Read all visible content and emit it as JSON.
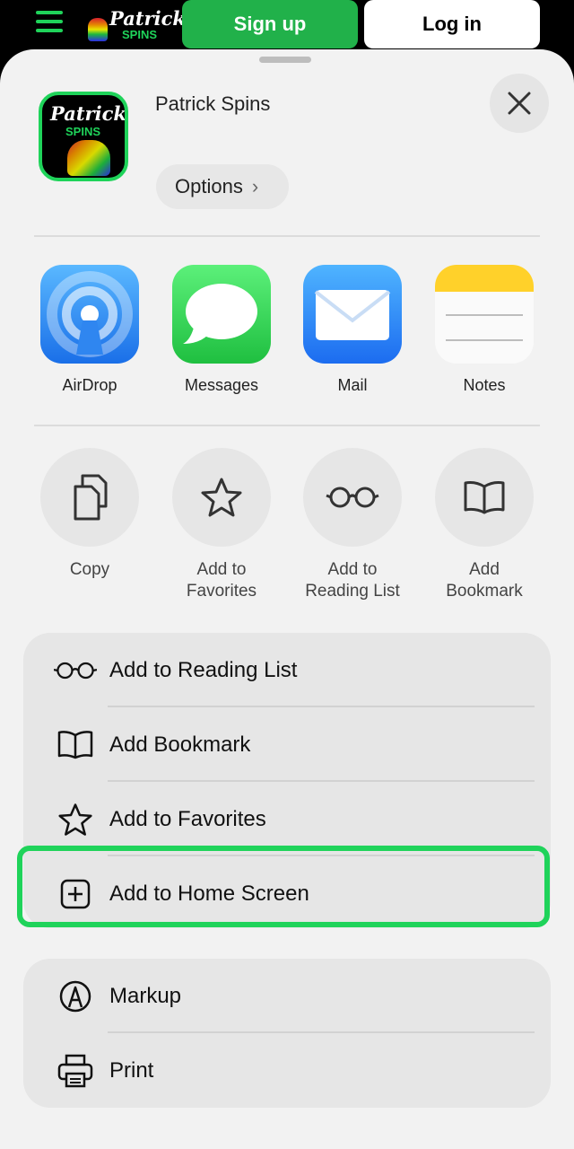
{
  "site_header": {
    "logo_line1": "Patrick",
    "logo_line2": "SPINS",
    "signup_label": "Sign up",
    "login_label": "Log in"
  },
  "share_sheet": {
    "app_name": "Patrick Spins",
    "app_icon_line1": "Patrick",
    "app_icon_line2": "SPINS",
    "options_label": "Options",
    "apps": [
      {
        "label": "AirDrop",
        "icon": "airdrop-icon"
      },
      {
        "label": "Messages",
        "icon": "messages-icon"
      },
      {
        "label": "Mail",
        "icon": "mail-icon"
      },
      {
        "label": "Notes",
        "icon": "notes-icon"
      }
    ],
    "actions": [
      {
        "label": "Copy",
        "icon": "copy-icon"
      },
      {
        "label": "Add to\nFavorites",
        "icon": "star-icon"
      },
      {
        "label": "Add to\nReading List",
        "icon": "glasses-icon"
      },
      {
        "label": "Add\nBookmark",
        "icon": "book-icon"
      }
    ],
    "list1": [
      {
        "label": "Add to Reading List",
        "icon": "glasses-icon"
      },
      {
        "label": "Add Bookmark",
        "icon": "book-icon"
      },
      {
        "label": "Add to Favorites",
        "icon": "star-icon"
      },
      {
        "label": "Add to Home Screen",
        "icon": "plus-square-icon"
      }
    ],
    "list2": [
      {
        "label": "Markup",
        "icon": "markup-icon"
      },
      {
        "label": "Print",
        "icon": "printer-icon"
      }
    ]
  },
  "colors": {
    "brand_green": "#1fd35a",
    "signup_green": "#21b14a",
    "sheet_bg": "#f2f2f2",
    "highlight": "#1fd35a"
  }
}
